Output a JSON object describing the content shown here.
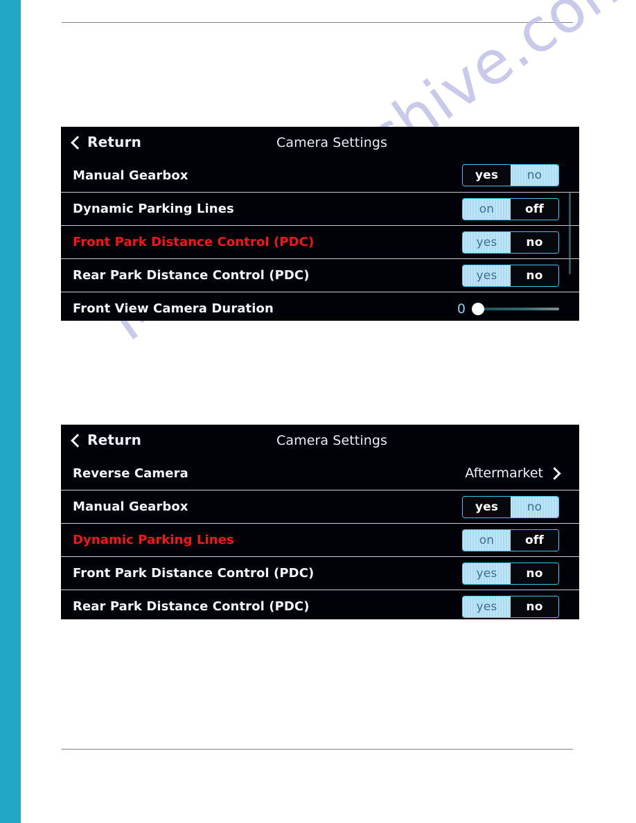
{
  "page": {
    "background_color": "#ffffff",
    "side_stripe_color": "#23a5c4",
    "rule_color": "#7d7d84",
    "watermark_text": "Manualsarchive.com",
    "watermark_color": "#bfc0e8"
  },
  "theme": {
    "screen_background": "#010108",
    "accent_border": "#39c6f2",
    "segment_inactive_bg": "#a8dcf2",
    "segment_inactive_text": "#3e6f93",
    "segment_active_text": "#ffffff",
    "label_color": "#f2f5fa",
    "highlight_color": "#f51616",
    "slider_value_color": "#7fd2ef",
    "divider_color": "#c9cfd4"
  },
  "screens": [
    {
      "id": "camera-settings-screen-1",
      "header": {
        "back_label": "Return",
        "back_icon": "chevron-left-icon",
        "title": "Camera Settings"
      },
      "rows": [
        {
          "label": "Manual Gearbox",
          "highlighted": false,
          "control": "toggle",
          "options": [
            "yes",
            "no"
          ],
          "selected": "yes"
        },
        {
          "label": "Dynamic Parking Lines",
          "highlighted": false,
          "control": "toggle",
          "options": [
            "on",
            "off"
          ],
          "selected": "off"
        },
        {
          "label": "Front Park Distance Control (PDC)",
          "highlighted": true,
          "control": "toggle",
          "options": [
            "yes",
            "no"
          ],
          "selected": "no"
        },
        {
          "label": "Rear Park Distance Control (PDC)",
          "highlighted": false,
          "control": "toggle",
          "options": [
            "yes",
            "no"
          ],
          "selected": "no"
        },
        {
          "label": "Front View Camera Duration",
          "highlighted": false,
          "control": "slider",
          "value": "0",
          "knob_position_percent": 0
        }
      ]
    },
    {
      "id": "camera-settings-screen-2",
      "header": {
        "back_label": "Return",
        "back_icon": "chevron-left-icon",
        "title": "Camera Settings"
      },
      "rows": [
        {
          "label": "Reverse Camera",
          "highlighted": false,
          "control": "value",
          "value": "Aftermarket",
          "value_icon": "chevron-right-icon"
        },
        {
          "label": "Manual Gearbox",
          "highlighted": false,
          "control": "toggle",
          "options": [
            "yes",
            "no"
          ],
          "selected": "yes"
        },
        {
          "label": "Dynamic Parking Lines",
          "highlighted": true,
          "control": "toggle",
          "options": [
            "on",
            "off"
          ],
          "selected": "off"
        },
        {
          "label": "Front Park Distance Control (PDC)",
          "highlighted": false,
          "control": "toggle",
          "options": [
            "yes",
            "no"
          ],
          "selected": "no"
        },
        {
          "label": "Rear Park Distance Control (PDC)",
          "highlighted": false,
          "control": "toggle",
          "options": [
            "yes",
            "no"
          ],
          "selected": "no"
        }
      ]
    }
  ]
}
